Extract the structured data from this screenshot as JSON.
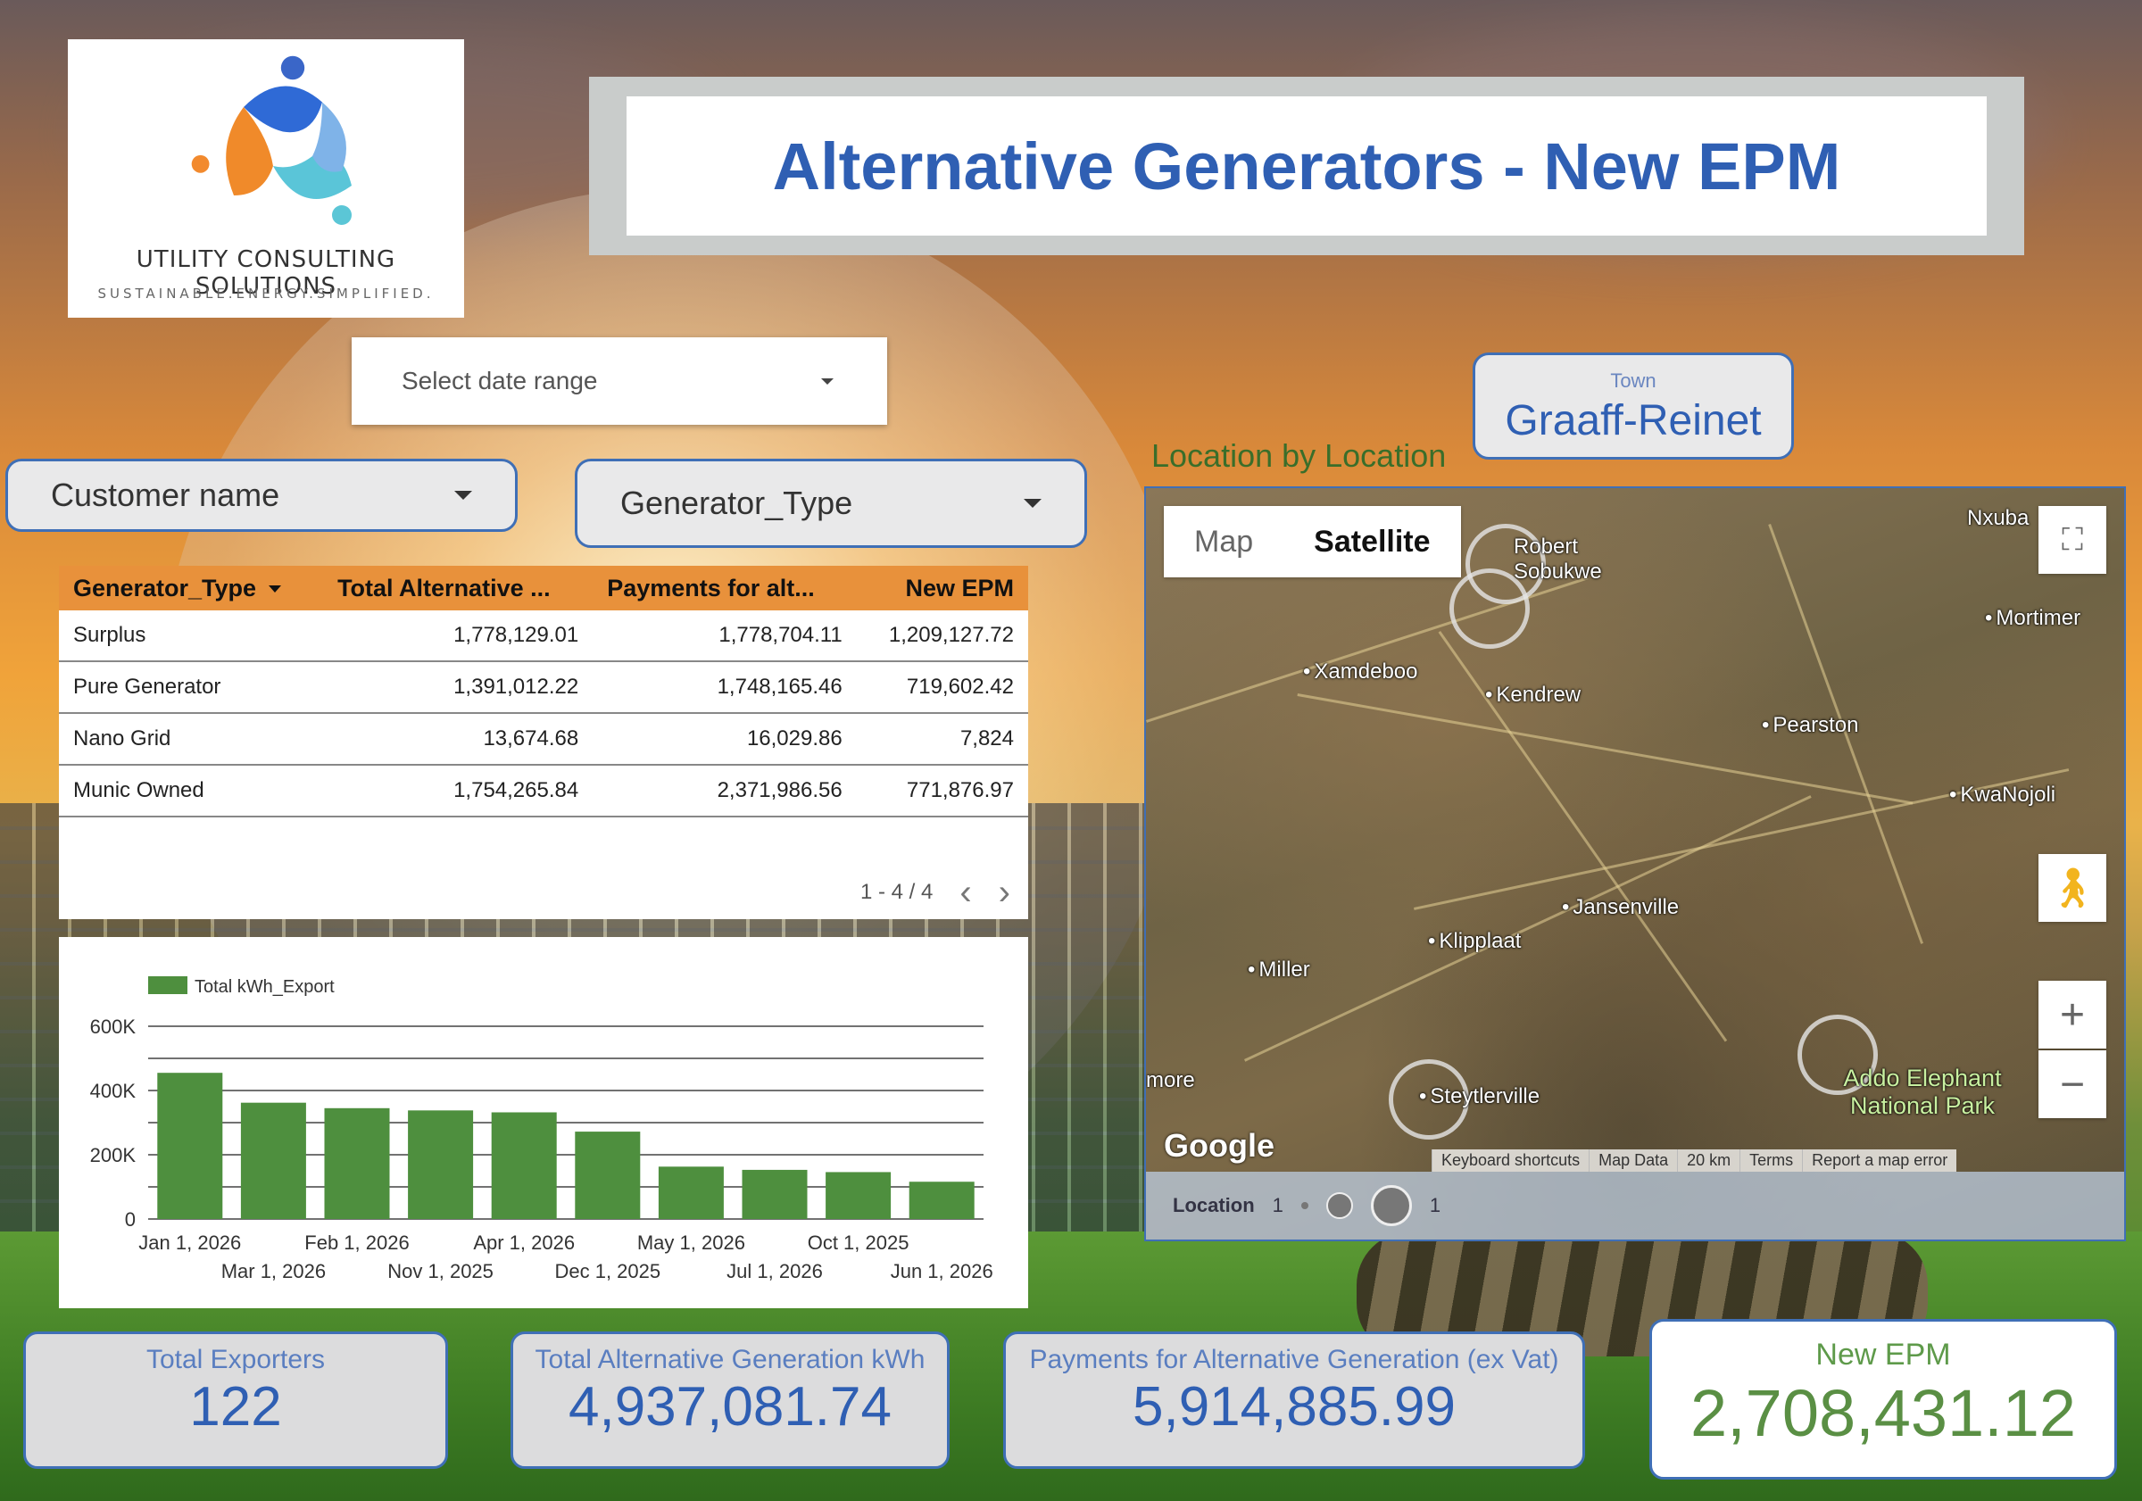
{
  "brand": {
    "company": "UTILITY CONSULTING SOLUTIONS",
    "tagline": "SUSTAINABLE.ENERGY.SIMPLIFIED."
  },
  "header": {
    "title": "Alternative Generators - New EPM"
  },
  "controls": {
    "date_range_label": "Select date range",
    "customer_filter_label": "Customer name",
    "generator_filter_label": "Generator_Type",
    "town_label": "Town",
    "town_value": "Graaff-Reinet"
  },
  "table": {
    "columns": [
      "Generator_Type",
      "Total Alternative ...",
      "Payments for alt...",
      "New EPM"
    ],
    "rows": [
      [
        "Surplus",
        "1,778,129.01",
        "1,778,704.11",
        "1,209,127.72"
      ],
      [
        "Pure Generator",
        "1,391,012.22",
        "1,748,165.46",
        "719,602.42"
      ],
      [
        "Nano Grid",
        "13,674.68",
        "16,029.86",
        "7,824"
      ],
      [
        "Munic Owned",
        "1,754,265.84",
        "2,371,986.56",
        "771,876.97"
      ]
    ],
    "pagination": "1 - 4 / 4"
  },
  "chart_data": {
    "type": "bar",
    "categories": [
      "Jan 1, 2026",
      "Mar 1, 2026",
      "Feb 1, 2026",
      "Nov 1, 2025",
      "Apr 1, 2026",
      "Dec 1, 2025",
      "May 1, 2026",
      "Jul 1, 2026",
      "Oct 1, 2025",
      "Jun 1, 2026"
    ],
    "series": [
      {
        "name": "Total kWh_Export",
        "values": [
          455000,
          362000,
          345000,
          338000,
          332000,
          272000,
          163000,
          153000,
          146000,
          116000
        ]
      }
    ],
    "y_ticks": [
      "0",
      "200K",
      "400K",
      "600K"
    ],
    "ylim": [
      0,
      600000
    ],
    "color": "#4e8f3e"
  },
  "map": {
    "title": "Location by Location",
    "mode_map": "Map",
    "mode_satellite": "Satellite",
    "places": [
      "Nxuba",
      "Robert Sobukwe",
      "Mortimer",
      "Xamdeboo",
      "Kendrew",
      "Pearston",
      "KwaNojoli",
      "Jansenville",
      "Klipplaat",
      "Miller",
      "more",
      "Steytlerville",
      "Addo Elephant National Park"
    ],
    "footer": [
      "Keyboard shortcuts",
      "Map Data",
      "20 km",
      "Terms",
      "Report a map error"
    ],
    "google": "Google",
    "legend_label": "Location",
    "legend_min": "1",
    "legend_max": "1"
  },
  "kpis": {
    "total_exporters_label": "Total Exporters",
    "total_exporters_value": "122",
    "total_gen_label": "Total Alternative Generation kWh",
    "total_gen_value": "4,937,081.74",
    "payments_label": "Payments for Alternative Generation (ex Vat)",
    "payments_value": "5,914,885.99",
    "new_epm_label": "New EPM",
    "new_epm_value": "2,708,431.12"
  }
}
